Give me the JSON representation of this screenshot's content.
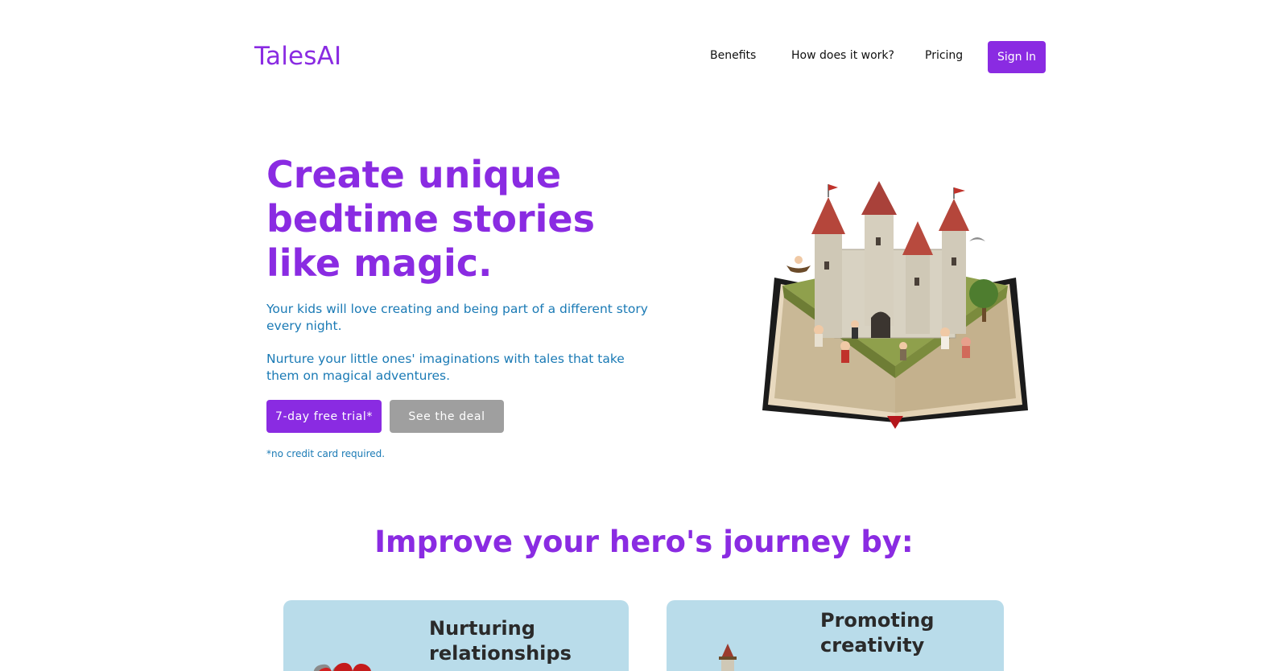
{
  "header": {
    "logo": "TalesAI",
    "nav": [
      "Benefits",
      "How does it work?",
      "Pricing"
    ],
    "sign_in": "Sign In"
  },
  "hero": {
    "title": "Create unique bedtime stories like magic.",
    "paragraph1": "Your kids will love creating and being part of a different story every night.",
    "paragraph2": "Nurture your little ones' imaginations with tales that take them on magical adventures.",
    "trial_button": "7-day free trial*",
    "deal_button": "See the deal",
    "fine_print": "*no credit card required."
  },
  "benefits": {
    "title": "Improve your hero's journey by:",
    "cards": [
      {
        "title": "Nurturing relationships"
      },
      {
        "title": "Promoting creativity"
      }
    ]
  },
  "colors": {
    "brand": "#8a2be2",
    "body_text": "#1a7ab5",
    "secondary_button": "#9f9f9f",
    "card_bg": "#b9dcea"
  }
}
